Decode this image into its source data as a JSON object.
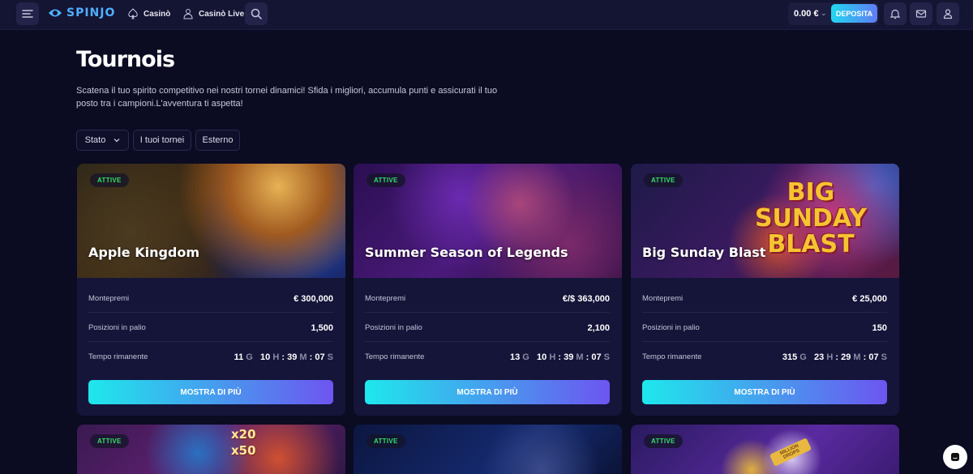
{
  "nav": {
    "logo": "SPINJO",
    "links": [
      "Casinò",
      "Casinò Live"
    ],
    "balance": "0.00 €",
    "deposit": "DEPOSITA"
  },
  "header": {
    "title": "Tournois",
    "description": "Scatena il tuo spirito competitivo nei nostri tornei dinamici! Sfida i migliori, accumula punti e assicurati il tuo posto tra i campioni.L'avventura ti aspetta!"
  },
  "filters": [
    "Stato",
    "I tuoi tornei",
    "Esterno"
  ],
  "labels": {
    "prize": "Montepremi",
    "positions": "Posizioni in palio",
    "time": "Tempo rimanente",
    "button": "MOSTRA DI PIÙ",
    "active": "ATTIVE",
    "units": [
      "G",
      "H",
      "M",
      "S"
    ]
  },
  "cards": [
    {
      "title": "Apple Kingdom",
      "badge": "ATTIVE",
      "prize": "€ 300,000",
      "positions": "1,500",
      "days": "11",
      "hours": "10",
      "minutes": "39",
      "seconds": "07"
    },
    {
      "title": "Summer Season of Legends",
      "badge": "ATTIVE",
      "prize": "€/$ 363,000",
      "positions": "2,100",
      "days": "13",
      "hours": "10",
      "minutes": "39",
      "seconds": "07"
    },
    {
      "title": "Big Sunday Blast",
      "badge": "ATTIVE",
      "prize": "€ 25,000",
      "positions": "150",
      "days": "315",
      "hours": "23",
      "minutes": "29",
      "seconds": "07",
      "banner_text": [
        "BIG",
        "SUNDAY",
        "BLAST"
      ]
    }
  ],
  "more_cards": [
    {
      "badge": "ATTIVE",
      "banner_text": [
        "x20",
        "x50"
      ]
    },
    {
      "badge": "ATTIVE"
    },
    {
      "badge": "ATTIVE",
      "banner_text": "MILLION DROPS"
    }
  ],
  "colors": {
    "accent": "#21d8f0",
    "active_badge": "#35e06a",
    "background": "#0b0b22"
  }
}
